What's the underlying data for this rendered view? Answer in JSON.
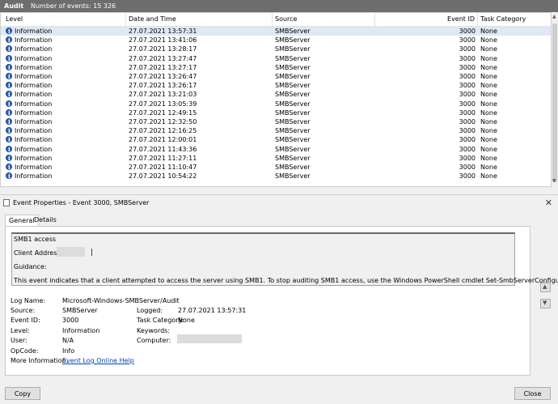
{
  "header": {
    "title": "Audit",
    "count": "Number of events: 15 326"
  },
  "columns": [
    "Level",
    "Date and Time",
    "Source",
    "Event ID",
    "Task Category"
  ],
  "events": [
    {
      "level": "Information",
      "date": "27.07.2021 13:57:31",
      "source": "SMBServer",
      "id": "3000",
      "task": "None"
    },
    {
      "level": "Information",
      "date": "27.07.2021 13:41:06",
      "source": "SMBServer",
      "id": "3000",
      "task": "None"
    },
    {
      "level": "Information",
      "date": "27.07.2021 13:28:17",
      "source": "SMBServer",
      "id": "3000",
      "task": "None"
    },
    {
      "level": "Information",
      "date": "27.07.2021 13:27:47",
      "source": "SMBServer",
      "id": "3000",
      "task": "None"
    },
    {
      "level": "Information",
      "date": "27.07.2021 13:27:17",
      "source": "SMBServer",
      "id": "3000",
      "task": "None"
    },
    {
      "level": "Information",
      "date": "27.07.2021 13:26:47",
      "source": "SMBServer",
      "id": "3000",
      "task": "None"
    },
    {
      "level": "Information",
      "date": "27.07.2021 13:26:17",
      "source": "SMBServer",
      "id": "3000",
      "task": "None"
    },
    {
      "level": "Information",
      "date": "27.07.2021 13:21:03",
      "source": "SMBServer",
      "id": "3000",
      "task": "None"
    },
    {
      "level": "Information",
      "date": "27.07.2021 13:05:39",
      "source": "SMBServer",
      "id": "3000",
      "task": "None"
    },
    {
      "level": "Information",
      "date": "27.07.2021 12:49:15",
      "source": "SMBServer",
      "id": "3000",
      "task": "None"
    },
    {
      "level": "Information",
      "date": "27.07.2021 12:32:50",
      "source": "SMBServer",
      "id": "3000",
      "task": "None"
    },
    {
      "level": "Information",
      "date": "27.07.2021 12:16:25",
      "source": "SMBServer",
      "id": "3000",
      "task": "None"
    },
    {
      "level": "Information",
      "date": "27.07.2021 12:00:01",
      "source": "SMBServer",
      "id": "3000",
      "task": "None"
    },
    {
      "level": "Information",
      "date": "27.07.2021 11:43:36",
      "source": "SMBServer",
      "id": "3000",
      "task": "None"
    },
    {
      "level": "Information",
      "date": "27.07.2021 11:27:11",
      "source": "SMBServer",
      "id": "3000",
      "task": "None"
    },
    {
      "level": "Information",
      "date": "27.07.2021 11:10:47",
      "source": "SMBServer",
      "id": "3000",
      "task": "None"
    },
    {
      "level": "Information",
      "date": "27.07.2021 10:54:22",
      "source": "SMBServer",
      "id": "3000",
      "task": "None"
    }
  ],
  "dialog": {
    "title": "Event Properties - Event 3000, SMBServer",
    "tabs": [
      "General",
      "Details"
    ],
    "desc": {
      "l1": "SMB1 access",
      "l2": "Client Address:",
      "l3": "Guidance:",
      "l4": "This event indicates that a client attempted to access the server using SMB1. To stop auditing SMB1 access, use the Windows PowerShell cmdlet Set-SmbServerConfiguration."
    },
    "props": {
      "log_name_k": "Log Name:",
      "log_name_v": "Microsoft-Windows-SMBServer/Audit",
      "source_k": "Source:",
      "source_v": "SMBServer",
      "logged_k": "Logged:",
      "logged_v": "27.07.2021 13:57:31",
      "eventid_k": "Event ID:",
      "eventid_v": "3000",
      "task_k": "Task Category:",
      "task_v": "None",
      "level_k": "Level:",
      "level_v": "Information",
      "keywords_k": "Keywords:",
      "user_k": "User:",
      "user_v": "N/A",
      "computer_k": "Computer:",
      "opcode_k": "OpCode:",
      "opcode_v": "Info",
      "moreinfo_k": "More Information:",
      "moreinfo_v": "Event Log Online Help"
    },
    "copy_label": "Copy",
    "close_label": "Close"
  },
  "icons": {
    "level": "information-icon",
    "up": "arrow-up-icon",
    "down": "arrow-down-icon"
  },
  "colors": {
    "header_bg": "#6d6d6d",
    "selection": "#dfe8f5",
    "link": "#0645ad"
  }
}
